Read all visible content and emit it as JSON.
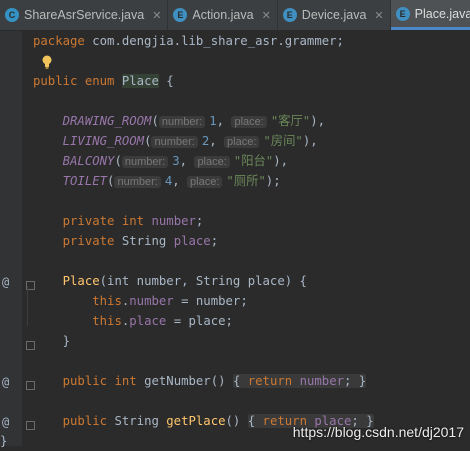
{
  "tabs": [
    {
      "label": "ShareAsrService.java",
      "icon": "class-file-icon",
      "active": false
    },
    {
      "label": "Action.java",
      "icon": "enum-file-icon",
      "active": false
    },
    {
      "label": "Device.java",
      "icon": "enum-file-icon",
      "active": false
    },
    {
      "label": "Place.java",
      "icon": "enum-file-icon",
      "active": true
    }
  ],
  "tab_close": "✕",
  "tab_icon_letters": {
    "class": "C",
    "enum": "E"
  },
  "code": {
    "package_kw": "package",
    "package_name": "com.dengjia.lib_share_asr.grammer",
    "public_kw": "public",
    "enum_kw": "enum",
    "class_name": "Place",
    "open_brace": "{",
    "constants": [
      {
        "name": "DRAWING_ROOM",
        "hint_number": "number:",
        "number": "1",
        "hint_place": "place:",
        "place": "\"客厅\"",
        "end": "),"
      },
      {
        "name": "LIVING_ROOM",
        "hint_number": "number:",
        "number": "2",
        "hint_place": "place:",
        "place": "\"房间\"",
        "end": "),"
      },
      {
        "name": "BALCONY",
        "hint_number": "number:",
        "number": "3",
        "hint_place": "place:",
        "place": "\"阳台\"",
        "end": "),"
      },
      {
        "name": "TOILET",
        "hint_number": "number:",
        "number": "4",
        "hint_place": "place:",
        "place": "\"厕所\"",
        "end": ");"
      }
    ],
    "field1_kw": "private",
    "field1_type": "int",
    "field1_name": "number",
    "field2_kw": "private",
    "field2_type": "String",
    "field2_name": "place",
    "ctor_name": "Place",
    "ctor_params": "(int number, String place) {",
    "ctor_this": "this",
    "ctor_line1_field": "number",
    "ctor_line1_rest": " = number;",
    "ctor_line2_field": "place",
    "ctor_line2_rest": " = place;",
    "close_brace": "}",
    "getter1_kw": "public",
    "getter1_type": "int",
    "getter1_name": "getNumber",
    "getter1_parens": "()",
    "getter1_body_kw": "return",
    "getter1_body_field": "number",
    "getter2_kw": "public",
    "getter2_type": "String",
    "getter2_name": "getPlace",
    "getter2_parens": "()",
    "getter2_body_kw": "return",
    "getter2_body_field": "place",
    "final_brace": "}"
  },
  "gutter_marks": [
    "@",
    "@",
    "@"
  ],
  "watermark": "https://blog.csdn.net/dj2017"
}
